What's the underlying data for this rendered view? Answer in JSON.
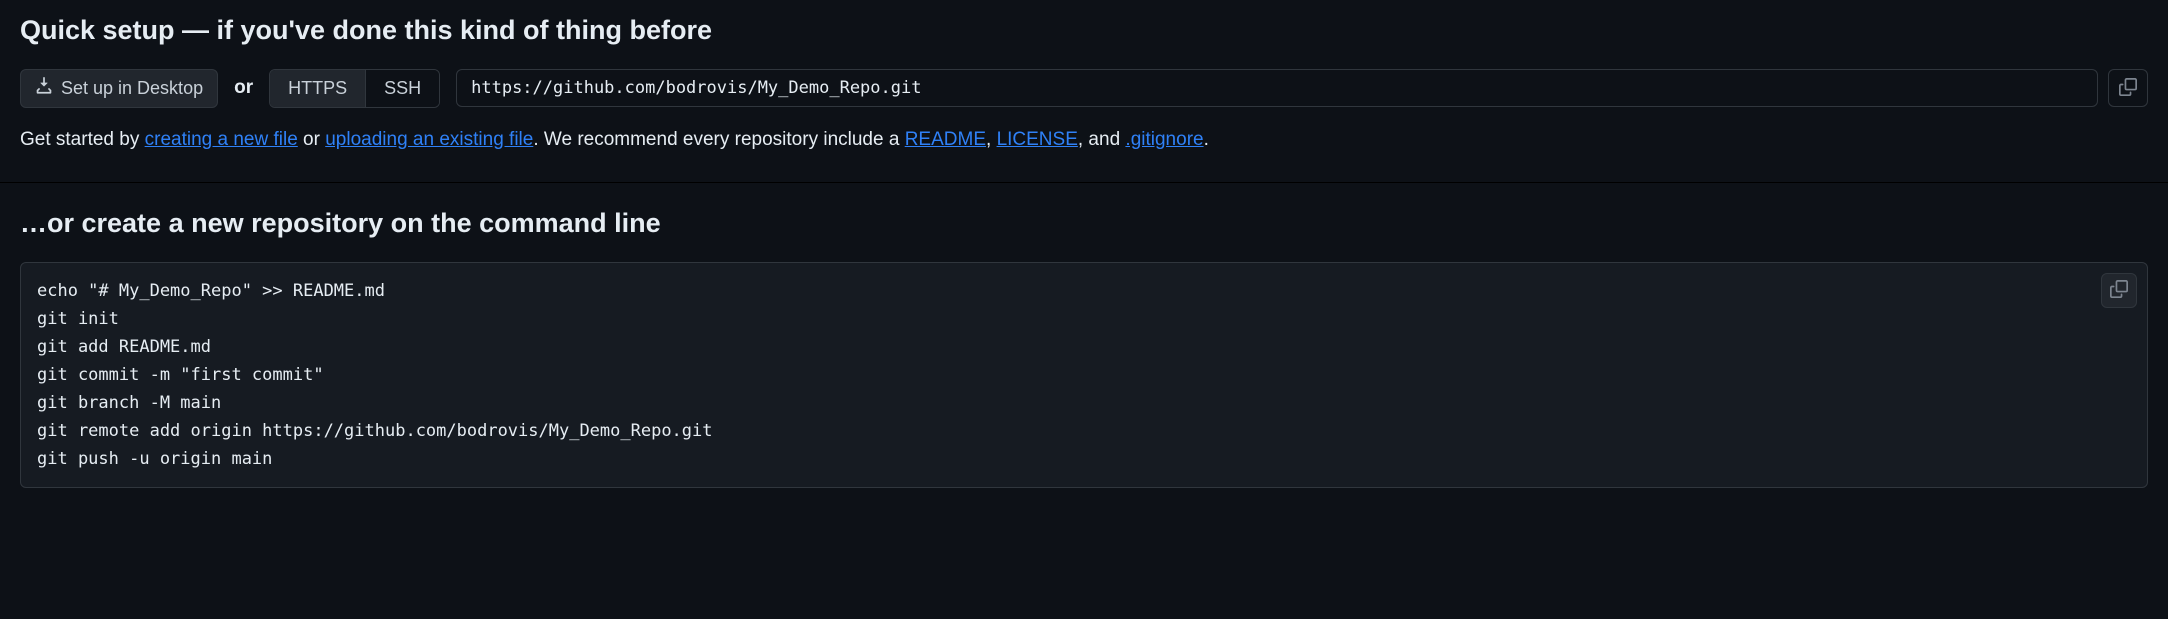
{
  "quick_setup": {
    "heading": "Quick setup — if you've done this kind of thing before",
    "desktop_button": "Set up in Desktop",
    "or_label": "or",
    "proto_https": "HTTPS",
    "proto_ssh": "SSH",
    "clone_url": "https://github.com/bodrovis/My_Demo_Repo.git",
    "starter": {
      "prefix": "Get started by ",
      "link_create": "creating a new file",
      "mid1": " or ",
      "link_upload": "uploading an existing file",
      "mid2": ". We recommend every repository include a ",
      "link_readme": "README",
      "sep1": ", ",
      "link_license": "LICENSE",
      "sep2": ", and ",
      "link_gitignore": ".gitignore",
      "suffix": "."
    }
  },
  "cmdline": {
    "heading": "…or create a new repository on the command line",
    "code": "echo \"# My_Demo_Repo\" >> README.md\ngit init\ngit add README.md\ngit commit -m \"first commit\"\ngit branch -M main\ngit remote add origin https://github.com/bodrovis/My_Demo_Repo.git\ngit push -u origin main"
  }
}
